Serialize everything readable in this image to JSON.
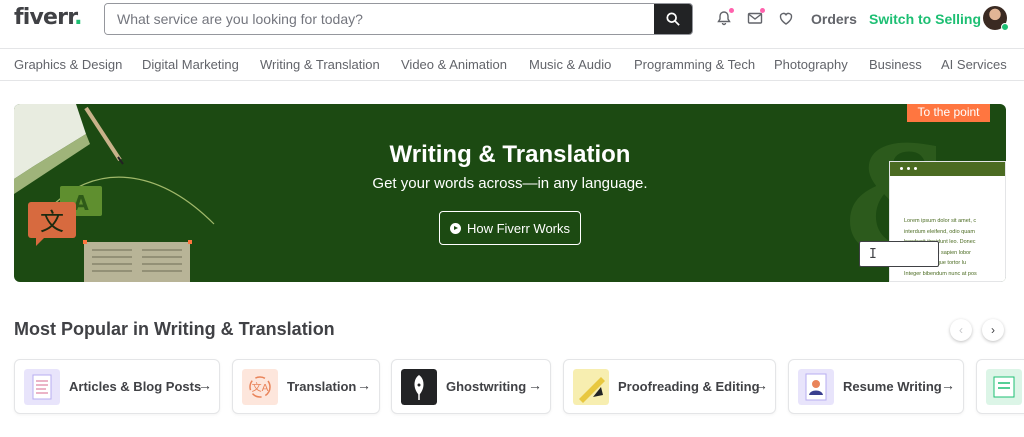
{
  "header": {
    "logo": "fiverr",
    "logo_dot": ".",
    "search_placeholder": "What service are you looking for today?",
    "orders": "Orders",
    "switch_selling": "Switch to Selling",
    "icons": [
      "search-icon",
      "bell-icon",
      "mail-icon",
      "heart-icon"
    ]
  },
  "categories": [
    "Graphics & Design",
    "Digital Marketing",
    "Writing & Translation",
    "Video & Animation",
    "Music & Audio",
    "Programming & Tech",
    "Photography",
    "Business",
    "AI Services"
  ],
  "hero": {
    "title": "Writing & Translation",
    "subtitle": "Get your words across—in any language.",
    "button": "How Fiverr Works",
    "tag": "To the point",
    "doc_lines": [
      "Lorem ipsum dolor sit amet, c",
      "interdum eleifend, odio quam",
      "hendrerit tincidunt leo. Donec",
      "usce mauris id sapien lobor",
      "o, a pellentesque tortor lu",
      "Integer bibendum nunc at pos"
    ],
    "cursor": "I",
    "accent_color": "#1c4a12"
  },
  "section": {
    "title": "Most Popular in Writing & Translation",
    "prev": "‹",
    "next": "›"
  },
  "cards": [
    {
      "label": "Articles & Blog Posts",
      "arrow": "→",
      "thumb_color": "#e8e4fb",
      "icon": "document-icon"
    },
    {
      "label": "Translation",
      "arrow": "→",
      "thumb_color": "#fde6dc",
      "icon": "translation-icon"
    },
    {
      "label": "Ghostwriting",
      "arrow": "→",
      "thumb_color": "#222325",
      "icon": "feather-pen-icon"
    },
    {
      "label": "Proofreading & Editing",
      "arrow": "→",
      "thumb_color": "#f7eeb0",
      "icon": "pencil-icon"
    },
    {
      "label": "Resume Writing",
      "arrow": "→",
      "thumb_color": "#e8e4fb",
      "icon": "resume-icon"
    }
  ]
}
